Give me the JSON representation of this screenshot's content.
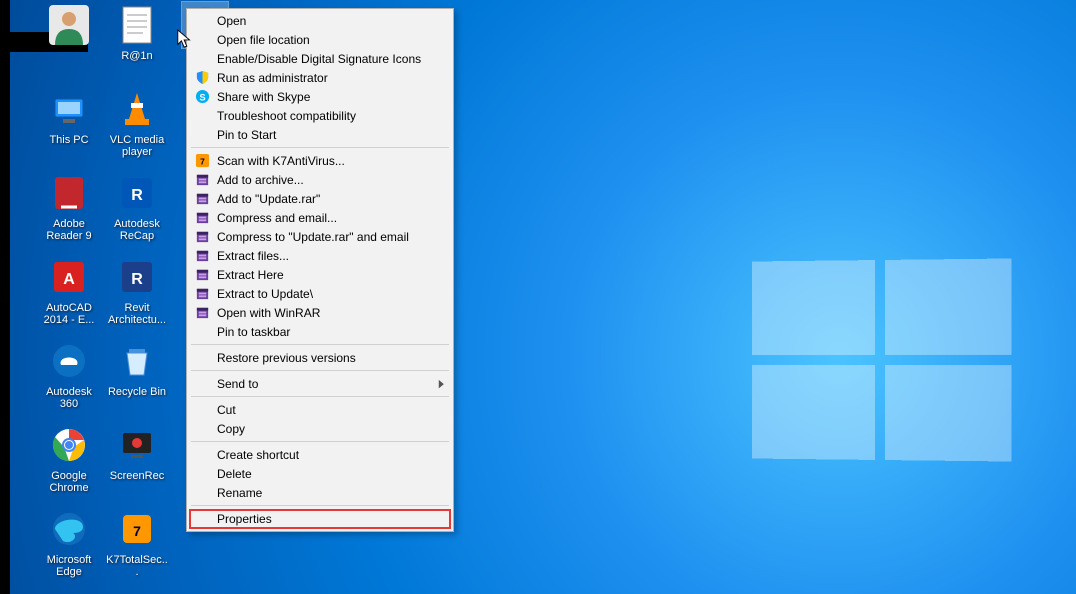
{
  "desktop": {
    "icons": [
      {
        "label": "",
        "type": "user"
      },
      {
        "label": "R@1n",
        "type": "textfile"
      },
      {
        "label": "",
        "type": "discord"
      },
      {
        "label": "This PC",
        "type": "thispc"
      },
      {
        "label": "VLC media player",
        "type": "vlc"
      },
      {
        "label": "",
        "type": "blank"
      },
      {
        "label": "Adobe Reader 9",
        "type": "pdf"
      },
      {
        "label": "Autodesk ReCap",
        "type": "recap"
      },
      {
        "label": "",
        "type": "blank"
      },
      {
        "label": "AutoCAD 2014 - E...",
        "type": "autocad"
      },
      {
        "label": "Revit Architectu...",
        "type": "revit"
      },
      {
        "label": "",
        "type": "blank"
      },
      {
        "label": "Autodesk 360",
        "type": "a360"
      },
      {
        "label": "Recycle Bin",
        "type": "recycle"
      },
      {
        "label": "",
        "type": "blank"
      },
      {
        "label": "Google Chrome",
        "type": "chrome"
      },
      {
        "label": "ScreenRec",
        "type": "screenrec"
      },
      {
        "label": "",
        "type": "blank"
      },
      {
        "label": "Microsoft Edge",
        "type": "edge"
      },
      {
        "label": "K7TotalSec...",
        "type": "k7total"
      },
      {
        "label": "",
        "type": "blank"
      }
    ]
  },
  "context_menu": {
    "groups": [
      [
        {
          "label": "Open",
          "icon": ""
        },
        {
          "label": "Open file location",
          "icon": ""
        },
        {
          "label": "Enable/Disable Digital Signature Icons",
          "icon": ""
        },
        {
          "label": "Run as administrator",
          "icon": "shield"
        },
        {
          "label": "Share with Skype",
          "icon": "skype"
        },
        {
          "label": "Troubleshoot compatibility",
          "icon": ""
        },
        {
          "label": "Pin to Start",
          "icon": ""
        }
      ],
      [
        {
          "label": "Scan with K7AntiVirus...",
          "icon": "k7"
        },
        {
          "label": "Add to archive...",
          "icon": "rar"
        },
        {
          "label": "Add to \"Update.rar\"",
          "icon": "rar"
        },
        {
          "label": "Compress and email...",
          "icon": "rar"
        },
        {
          "label": "Compress to \"Update.rar\" and email",
          "icon": "rar"
        },
        {
          "label": "Extract files...",
          "icon": "rar"
        },
        {
          "label": "Extract Here",
          "icon": "rar"
        },
        {
          "label": "Extract to Update\\",
          "icon": "rar"
        },
        {
          "label": "Open with WinRAR",
          "icon": "rar"
        },
        {
          "label": "Pin to taskbar",
          "icon": ""
        }
      ],
      [
        {
          "label": "Restore previous versions",
          "icon": ""
        }
      ],
      [
        {
          "label": "Send to",
          "icon": "",
          "submenu": true
        }
      ],
      [
        {
          "label": "Cut",
          "icon": ""
        },
        {
          "label": "Copy",
          "icon": ""
        }
      ],
      [
        {
          "label": "Create shortcut",
          "icon": ""
        },
        {
          "label": "Delete",
          "icon": ""
        },
        {
          "label": "Rename",
          "icon": ""
        }
      ],
      [
        {
          "label": "Properties",
          "icon": "",
          "highlight": true
        }
      ]
    ]
  }
}
